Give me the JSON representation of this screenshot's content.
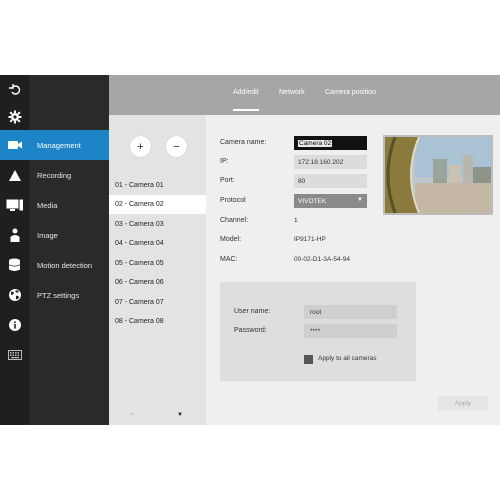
{
  "tabs": [
    {
      "label": "Add/edit",
      "active": true
    },
    {
      "label": "Network",
      "active": false
    },
    {
      "label": "Camera position",
      "active": false
    }
  ],
  "rail_icons": [
    "logout-icon",
    "gear-icon",
    "camera-icon",
    "alert-icon",
    "monitor-icon",
    "person-icon",
    "database-icon",
    "globe-icon",
    "info-icon",
    "keyboard-icon"
  ],
  "menu": [
    {
      "label": "Management",
      "active": true
    },
    {
      "label": "Recording",
      "active": false
    },
    {
      "label": "Media",
      "active": false
    },
    {
      "label": "Image",
      "active": false
    },
    {
      "label": "Motion detection",
      "active": false
    },
    {
      "label": "PTZ settings",
      "active": false
    }
  ],
  "camera_list": {
    "add_label": "+",
    "remove_label": "−",
    "items": [
      "01 - Camera 01",
      "02 - Camera 02",
      "03 - Camera 03",
      "04 - Camera 04",
      "05 - Camera 05",
      "06 - Camera 06",
      "07 - Camera 07",
      "08 - Camera 08"
    ],
    "selected_index": 1,
    "scroll_up": "▲",
    "scroll_down": "▼"
  },
  "form": {
    "camera_name_label": "Camera name:",
    "camera_name_value": "Camera 02",
    "ip_label": "IP:",
    "ip_value": "172.18.160.202",
    "port_label": "Port:",
    "port_value": "80",
    "protocol_label": "Protocol",
    "protocol_value": "VIVOTEK",
    "channel_label": "Channel:",
    "channel_value": "1",
    "model_label": "Model:",
    "model_value": "IP9171-HP",
    "mac_label": "MAC:",
    "mac_value": "00-02-D1-3A-54-94"
  },
  "credentials": {
    "username_label": "User name:",
    "username_value": "root",
    "password_label": "Password:",
    "password_value": "****",
    "apply_all_label": "Apply to all cameras",
    "apply_all_checked": false
  },
  "apply_label": "Apply",
  "colors": {
    "accent": "#1d84c8",
    "rail_bg": "#1f1f1f",
    "menu_bg": "#2a2a2a",
    "header_bg": "#a6a6a6"
  }
}
